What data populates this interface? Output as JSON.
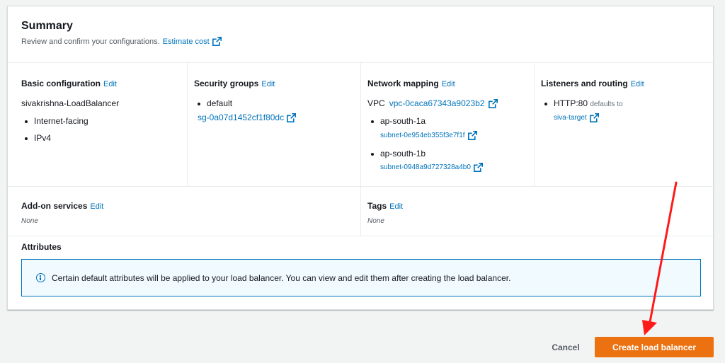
{
  "summary": {
    "title": "Summary",
    "description": "Review and confirm your configurations.",
    "estimate_cost": "Estimate cost"
  },
  "basic_config": {
    "heading": "Basic configuration",
    "edit": "Edit",
    "name": "sivakrishna-LoadBalancer",
    "scheme": "Internet-facing",
    "ip_type": "IPv4"
  },
  "security_groups": {
    "heading": "Security groups",
    "edit": "Edit",
    "group_name": "default",
    "group_id": "sg-0a07d1452cf1f80dc"
  },
  "network_mapping": {
    "heading": "Network mapping",
    "edit": "Edit",
    "vpc_label": "VPC",
    "vpc_id": "vpc-0caca67343a9023b2",
    "zones": [
      {
        "name": "ap-south-1a",
        "subnet": "subnet-0e954eb355f3e7f1f"
      },
      {
        "name": "ap-south-1b",
        "subnet": "subnet-0948a9d727328a4b0"
      }
    ]
  },
  "listeners": {
    "heading": "Listeners and routing",
    "edit": "Edit",
    "listener": "HTTP:80",
    "defaults_to": "defaults to",
    "target": "siva-target"
  },
  "addon": {
    "heading": "Add-on services",
    "edit": "Edit",
    "value": "None"
  },
  "tags": {
    "heading": "Tags",
    "edit": "Edit",
    "value": "None"
  },
  "attributes": {
    "heading": "Attributes",
    "info": "Certain default attributes will be applied to your load balancer. You can view and edit them after creating the load balancer."
  },
  "actions": {
    "cancel": "Cancel",
    "create": "Create load balancer"
  },
  "colors": {
    "primary": "#ec7211",
    "link": "#0073bb",
    "annotation_arrow": "#ff0000"
  }
}
